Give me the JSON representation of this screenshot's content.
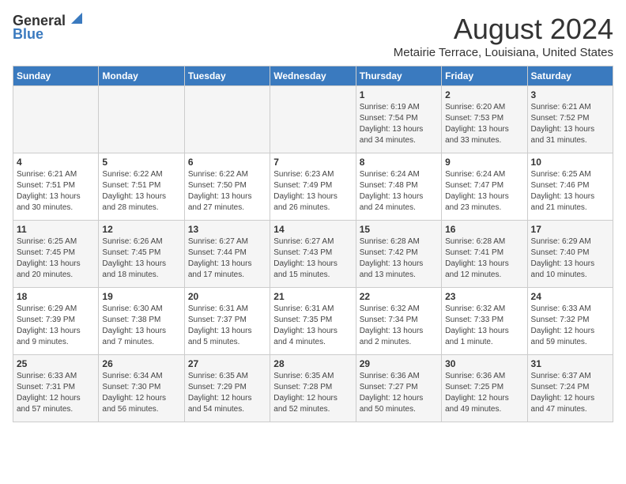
{
  "header": {
    "logo_general": "General",
    "logo_blue": "Blue",
    "month_title": "August 2024",
    "location": "Metairie Terrace, Louisiana, United States"
  },
  "days_of_week": [
    "Sunday",
    "Monday",
    "Tuesday",
    "Wednesday",
    "Thursday",
    "Friday",
    "Saturday"
  ],
  "weeks": [
    [
      {
        "day": "",
        "content": ""
      },
      {
        "day": "",
        "content": ""
      },
      {
        "day": "",
        "content": ""
      },
      {
        "day": "",
        "content": ""
      },
      {
        "day": "1",
        "content": "Sunrise: 6:19 AM\nSunset: 7:54 PM\nDaylight: 13 hours\nand 34 minutes."
      },
      {
        "day": "2",
        "content": "Sunrise: 6:20 AM\nSunset: 7:53 PM\nDaylight: 13 hours\nand 33 minutes."
      },
      {
        "day": "3",
        "content": "Sunrise: 6:21 AM\nSunset: 7:52 PM\nDaylight: 13 hours\nand 31 minutes."
      }
    ],
    [
      {
        "day": "4",
        "content": "Sunrise: 6:21 AM\nSunset: 7:51 PM\nDaylight: 13 hours\nand 30 minutes."
      },
      {
        "day": "5",
        "content": "Sunrise: 6:22 AM\nSunset: 7:51 PM\nDaylight: 13 hours\nand 28 minutes."
      },
      {
        "day": "6",
        "content": "Sunrise: 6:22 AM\nSunset: 7:50 PM\nDaylight: 13 hours\nand 27 minutes."
      },
      {
        "day": "7",
        "content": "Sunrise: 6:23 AM\nSunset: 7:49 PM\nDaylight: 13 hours\nand 26 minutes."
      },
      {
        "day": "8",
        "content": "Sunrise: 6:24 AM\nSunset: 7:48 PM\nDaylight: 13 hours\nand 24 minutes."
      },
      {
        "day": "9",
        "content": "Sunrise: 6:24 AM\nSunset: 7:47 PM\nDaylight: 13 hours\nand 23 minutes."
      },
      {
        "day": "10",
        "content": "Sunrise: 6:25 AM\nSunset: 7:46 PM\nDaylight: 13 hours\nand 21 minutes."
      }
    ],
    [
      {
        "day": "11",
        "content": "Sunrise: 6:25 AM\nSunset: 7:45 PM\nDaylight: 13 hours\nand 20 minutes."
      },
      {
        "day": "12",
        "content": "Sunrise: 6:26 AM\nSunset: 7:45 PM\nDaylight: 13 hours\nand 18 minutes."
      },
      {
        "day": "13",
        "content": "Sunrise: 6:27 AM\nSunset: 7:44 PM\nDaylight: 13 hours\nand 17 minutes."
      },
      {
        "day": "14",
        "content": "Sunrise: 6:27 AM\nSunset: 7:43 PM\nDaylight: 13 hours\nand 15 minutes."
      },
      {
        "day": "15",
        "content": "Sunrise: 6:28 AM\nSunset: 7:42 PM\nDaylight: 13 hours\nand 13 minutes."
      },
      {
        "day": "16",
        "content": "Sunrise: 6:28 AM\nSunset: 7:41 PM\nDaylight: 13 hours\nand 12 minutes."
      },
      {
        "day": "17",
        "content": "Sunrise: 6:29 AM\nSunset: 7:40 PM\nDaylight: 13 hours\nand 10 minutes."
      }
    ],
    [
      {
        "day": "18",
        "content": "Sunrise: 6:29 AM\nSunset: 7:39 PM\nDaylight: 13 hours\nand 9 minutes."
      },
      {
        "day": "19",
        "content": "Sunrise: 6:30 AM\nSunset: 7:38 PM\nDaylight: 13 hours\nand 7 minutes."
      },
      {
        "day": "20",
        "content": "Sunrise: 6:31 AM\nSunset: 7:37 PM\nDaylight: 13 hours\nand 5 minutes."
      },
      {
        "day": "21",
        "content": "Sunrise: 6:31 AM\nSunset: 7:35 PM\nDaylight: 13 hours\nand 4 minutes."
      },
      {
        "day": "22",
        "content": "Sunrise: 6:32 AM\nSunset: 7:34 PM\nDaylight: 13 hours\nand 2 minutes."
      },
      {
        "day": "23",
        "content": "Sunrise: 6:32 AM\nSunset: 7:33 PM\nDaylight: 13 hours\nand 1 minute."
      },
      {
        "day": "24",
        "content": "Sunrise: 6:33 AM\nSunset: 7:32 PM\nDaylight: 12 hours\nand 59 minutes."
      }
    ],
    [
      {
        "day": "25",
        "content": "Sunrise: 6:33 AM\nSunset: 7:31 PM\nDaylight: 12 hours\nand 57 minutes."
      },
      {
        "day": "26",
        "content": "Sunrise: 6:34 AM\nSunset: 7:30 PM\nDaylight: 12 hours\nand 56 minutes."
      },
      {
        "day": "27",
        "content": "Sunrise: 6:35 AM\nSunset: 7:29 PM\nDaylight: 12 hours\nand 54 minutes."
      },
      {
        "day": "28",
        "content": "Sunrise: 6:35 AM\nSunset: 7:28 PM\nDaylight: 12 hours\nand 52 minutes."
      },
      {
        "day": "29",
        "content": "Sunrise: 6:36 AM\nSunset: 7:27 PM\nDaylight: 12 hours\nand 50 minutes."
      },
      {
        "day": "30",
        "content": "Sunrise: 6:36 AM\nSunset: 7:25 PM\nDaylight: 12 hours\nand 49 minutes."
      },
      {
        "day": "31",
        "content": "Sunrise: 6:37 AM\nSunset: 7:24 PM\nDaylight: 12 hours\nand 47 minutes."
      }
    ]
  ]
}
